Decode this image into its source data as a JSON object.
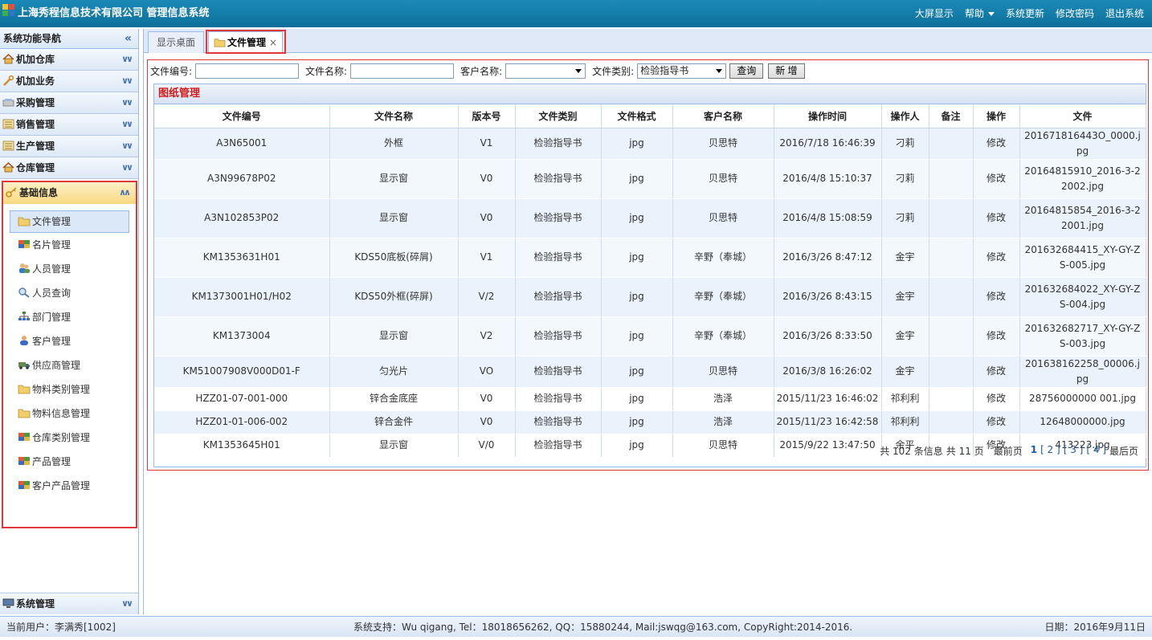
{
  "header": {
    "title": "上海秀程信息技术有限公司 管理信息系统",
    "menu": [
      "大屏显示",
      "帮助",
      "系统更新",
      "修改密码",
      "退出系统"
    ]
  },
  "sidebar": {
    "title": "系统功能导航",
    "groups": [
      {
        "label": "机加仓库",
        "icon": "house-icon"
      },
      {
        "label": "机加业务",
        "icon": "wrench-icon"
      },
      {
        "label": "采购管理",
        "icon": "cart-icon"
      },
      {
        "label": "销售管理",
        "icon": "list-icon"
      },
      {
        "label": "生产管理",
        "icon": "list-icon"
      },
      {
        "label": "仓库管理",
        "icon": "house-icon"
      }
    ],
    "active_group": "基础信息",
    "sub_items": [
      "文件管理",
      "名片管理",
      "人员管理",
      "人员查询",
      "部门管理",
      "客户管理",
      "供应商管理",
      "物料类别管理",
      "物料信息管理",
      "仓库类别管理",
      "产品管理",
      "客户产品管理"
    ],
    "bottom_group": "系统管理"
  },
  "tabs": [
    {
      "label": "显示桌面"
    },
    {
      "label": "文件管理",
      "close": "×"
    }
  ],
  "filters": {
    "file_no_label": "文件编号:",
    "file_name_label": "文件名称:",
    "customer_label": "客户名称:",
    "category_label": "文件类别:",
    "category_value": "检验指导书",
    "search_btn": "查询",
    "add_btn": "新 增"
  },
  "grid": {
    "title": "图纸管理",
    "columns": [
      "文件编号",
      "文件名称",
      "版本号",
      "文件类别",
      "文件格式",
      "客户名称",
      "操作时间",
      "操作人",
      "备注",
      "操作",
      "文件"
    ],
    "rows": [
      [
        "A3N65001",
        "外框",
        "V1",
        "检验指导书",
        "jpg",
        "贝思特",
        "2016/7/18 16:46:39",
        "刁莉",
        "",
        "修改",
        "201671816443O_0000.jpg"
      ],
      [
        "A3N99678P02",
        "显示窗",
        "V0",
        "检验指导书",
        "jpg",
        "贝思特",
        "2016/4/8 15:10:37",
        "刁莉",
        "",
        "修改",
        "20164815910_2016-3-22002.jpg"
      ],
      [
        "A3N102853P02",
        "显示窗",
        "V0",
        "检验指导书",
        "jpg",
        "贝思特",
        "2016/4/8 15:08:59",
        "刁莉",
        "",
        "修改",
        "20164815854_2016-3-22001.jpg"
      ],
      [
        "KM1353631H01",
        "KDS50底板(碎屑)",
        "V1",
        "检验指导书",
        "jpg",
        "辛野（奉城）",
        "2016/3/26 8:47:12",
        "金宇",
        "",
        "修改",
        "201632684415_XY-GY-ZS-005.jpg"
      ],
      [
        "KM1373001H01/H02",
        "KDS50外框(碎屏)",
        "V/2",
        "检验指导书",
        "jpg",
        "辛野（奉城）",
        "2016/3/26 8:43:15",
        "金宇",
        "",
        "修改",
        "201632684022_XY-GY-ZS-004.jpg"
      ],
      [
        "KM1373004",
        "显示窗",
        "V2",
        "检验指导书",
        "jpg",
        "辛野（奉城）",
        "2016/3/26 8:33:50",
        "金宇",
        "",
        "修改",
        "201632682717_XY-GY-ZS-003.jpg"
      ],
      [
        "KM51007908V000D01-F",
        "匀光片",
        "VO",
        "检验指导书",
        "jpg",
        "贝思特",
        "2016/3/8 16:26:02",
        "金宇",
        "",
        "修改",
        "201638162258_00006.jpg"
      ],
      [
        "HZZ01-07-001-000",
        "锌合金底座",
        "V0",
        "检验指导书",
        "jpg",
        "浩泽",
        "2015/11/23 16:46:02",
        "祁利利",
        "",
        "修改",
        "28756000000 001.jpg"
      ],
      [
        "HZZ01-01-006-002",
        "锌合金件",
        "V0",
        "检验指导书",
        "jpg",
        "浩泽",
        "2015/11/23 16:42:58",
        "祁利利",
        "",
        "修改",
        "12648000000.jpg"
      ],
      [
        "KM1353645H01",
        "显示窗",
        "V/0",
        "检验指导书",
        "jpg",
        "贝思特",
        "2015/9/22 13:47:50",
        "余平",
        "",
        "修改",
        "413223.jpg"
      ]
    ]
  },
  "pager": {
    "total_info": "共 102 条信息",
    "pages_info": "共 11 页",
    "first": "最前页",
    "current": "1",
    "pages": [
      "[ 2 ]",
      "[ 3 ]",
      "[ 4 ]"
    ],
    "last": "最后页"
  },
  "footer": {
    "user": "当前用户：李满秀[1002]",
    "support": "系统支持：Wu qigang, Tel：18018656262, QQ：15880244, Mail:jswqg@163.com, CopyRight:2014-2016.",
    "date": "日期：2016年9月11日"
  },
  "colors": {
    "header_bg": "#1b8ab8",
    "highlight_red": "#e0373a",
    "grid_title": "#d21c1c",
    "link_blue": "#1b58a8"
  }
}
